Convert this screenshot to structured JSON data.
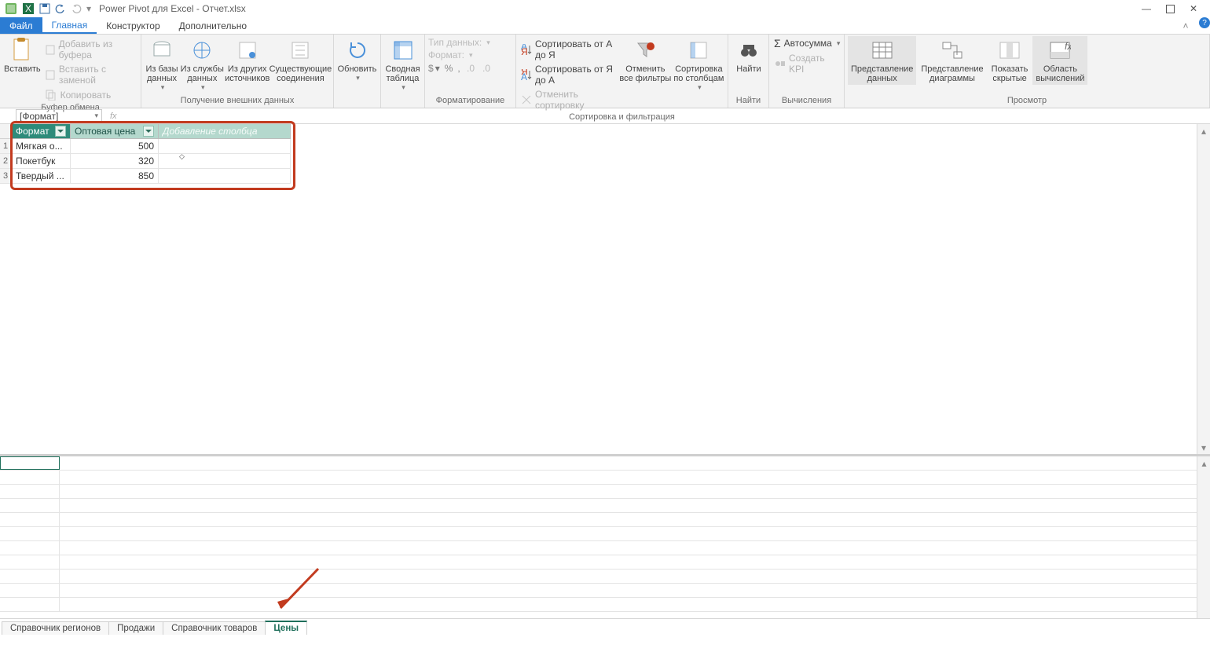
{
  "title": "Power Pivot для Excel - Отчет.xlsx",
  "tabs": {
    "file": "Файл",
    "home": "Главная",
    "design": "Конструктор",
    "advanced": "Дополнительно"
  },
  "ribbon": {
    "clipboard": {
      "paste": "Вставить",
      "addFromBuffer": "Добавить из буфера",
      "pasteReplace": "Вставить с заменой",
      "copy": "Копировать",
      "caption": "Буфер обмена"
    },
    "getdata": {
      "fromDb": "Из базы\nданных",
      "fromService": "Из службы\nданных",
      "fromOther": "Из других\nисточников",
      "existing": "Существующие\nсоединения",
      "caption": "Получение внешних данных"
    },
    "refresh": "Обновить",
    "pivot": "Сводная\nтаблица",
    "formatting": {
      "dataType": "Тип данных:",
      "format": "Формат:",
      "caption": "Форматирование",
      "sym_currency": "$",
      "sym_percent": "%",
      "sym_comma": ","
    },
    "sort": {
      "az": "Сортировать от А до Я",
      "za": "Сортировать от Я до А",
      "clear": "Отменить сортировку",
      "clearFilters": "Отменить\nвсе фильтры",
      "byColumns": "Сортировка\nпо столбцам",
      "caption": "Сортировка и фильтрация"
    },
    "find": {
      "find": "Найти",
      "caption": "Найти"
    },
    "calc": {
      "autosum": "Автосумма",
      "kpi": "Создать KPI",
      "caption": "Вычисления"
    },
    "view": {
      "dataView": "Представление\nданных",
      "diagramView": "Представление\nдиаграммы",
      "showHidden": "Показать\nскрытые",
      "calcArea": "Область\nвычислений",
      "caption": "Просмотр"
    }
  },
  "namebox": "[Формат]",
  "fx": "fx",
  "columns": {
    "format": "Формат",
    "price": "Оптовая цена",
    "add": "Добавление столбца"
  },
  "rows": [
    {
      "n": "1",
      "format": "Мягкая о...",
      "price": "500"
    },
    {
      "n": "2",
      "format": "Покетбук",
      "price": "320"
    },
    {
      "n": "3",
      "format": "Твердый ...",
      "price": "850"
    }
  ],
  "sheets": {
    "regions": "Справочник регионов",
    "sales": "Продажи",
    "products": "Справочник товаров",
    "prices": "Цены"
  }
}
